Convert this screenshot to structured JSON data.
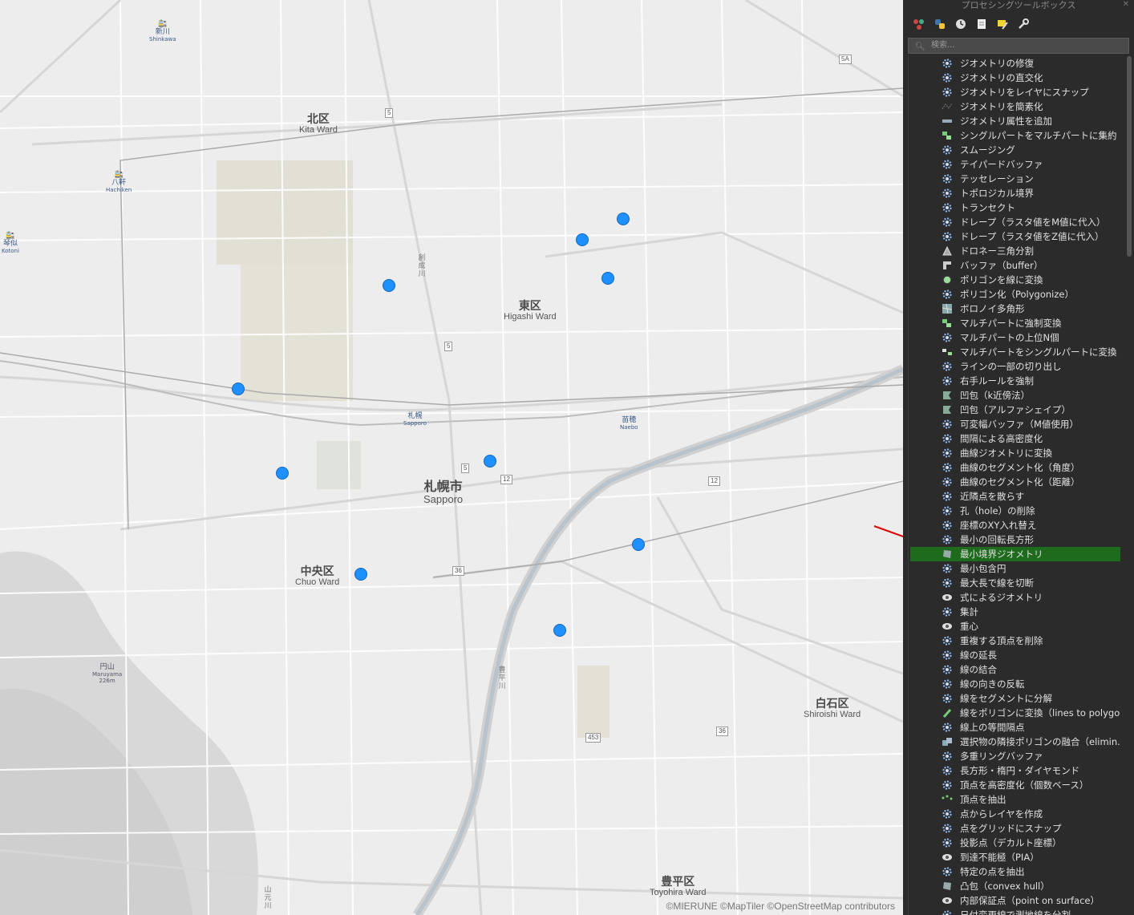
{
  "map": {
    "wards": [
      {
        "jp": "北区",
        "en": "Kita Ward"
      },
      {
        "jp": "東区",
        "en": "Higashi Ward"
      },
      {
        "jp": "札幌市",
        "en": "Sapporo"
      },
      {
        "jp": "中央区",
        "en": "Chuo Ward"
      },
      {
        "jp": "白石区",
        "en": "Shiroishi Ward"
      },
      {
        "jp": "豊平区",
        "en": "Toyohira Ward"
      }
    ],
    "stations": [
      {
        "jp": "新川",
        "en": "Shinkawa"
      },
      {
        "jp": "八軒",
        "en": "Hachiken"
      },
      {
        "jp": "琴似",
        "en": "Kotoni"
      },
      {
        "jp": "札幌",
        "en": "Sapporo"
      },
      {
        "jp": "苗穂",
        "en": "Naebo"
      }
    ],
    "mountain": {
      "jp": "円山",
      "en": "Maruyama",
      "height": "226m"
    },
    "route_shields": [
      "5",
      "5",
      "5",
      "12",
      "12",
      "36",
      "36",
      "453",
      "5A"
    ],
    "river_labels": [
      "創成川",
      "豊平川",
      "山元川"
    ],
    "attribution": "©MIERUNE ©MapTiler ©OpenStreetMap contributors",
    "marker_color": "#1e90ff"
  },
  "panel": {
    "title": "プロセシングツールボックス",
    "search_placeholder": "検索...",
    "selected_color": "#1e6b1e",
    "toolbar": [
      "model-icon",
      "python-icon",
      "history-icon",
      "results-icon",
      "edit-icon",
      "settings-icon"
    ],
    "items": [
      {
        "label": "ジオメトリの修復",
        "icon": "gear"
      },
      {
        "label": "ジオメトリの直交化",
        "icon": "gear"
      },
      {
        "label": "ジオメトリをレイヤにスナップ",
        "icon": "gear"
      },
      {
        "label": "ジオメトリを簡素化",
        "icon": "simplify"
      },
      {
        "label": "ジオメトリ属性を追加",
        "icon": "ruler"
      },
      {
        "label": "シングルパートをマルチパートに集約",
        "icon": "collect"
      },
      {
        "label": "スムージング",
        "icon": "gear"
      },
      {
        "label": "テイパードバッファ",
        "icon": "gear"
      },
      {
        "label": "テッセレーション",
        "icon": "gear"
      },
      {
        "label": "トポロジカル境界",
        "icon": "gear"
      },
      {
        "label": "トランセクト",
        "icon": "gear"
      },
      {
        "label": "ドレープ（ラスタ値をM値に代入）",
        "icon": "gear"
      },
      {
        "label": "ドレープ（ラスタ値をZ値に代入）",
        "icon": "gear"
      },
      {
        "label": "ドロネー三角分割",
        "icon": "delaunay"
      },
      {
        "label": "バッファ（buffer）",
        "icon": "buffer"
      },
      {
        "label": "ポリゴンを線に変換",
        "icon": "polytoline"
      },
      {
        "label": "ポリゴン化（Polygonize）",
        "icon": "gear"
      },
      {
        "label": "ボロノイ多角形",
        "icon": "voronoi"
      },
      {
        "label": "マルチパートに強制変換",
        "icon": "collect"
      },
      {
        "label": "マルチパートの上位N個",
        "icon": "gear"
      },
      {
        "label": "マルチパートをシングルパートに変換",
        "icon": "explode"
      },
      {
        "label": "ラインの一部の切り出し",
        "icon": "gear"
      },
      {
        "label": "右手ルールを強制",
        "icon": "gear"
      },
      {
        "label": "凹包（k近傍法）",
        "icon": "concave"
      },
      {
        "label": "凹包（アルファシェイプ）",
        "icon": "concave"
      },
      {
        "label": "可変幅バッファ（M値使用）",
        "icon": "gear"
      },
      {
        "label": "間隔による高密度化",
        "icon": "gear"
      },
      {
        "label": "曲線ジオメトリに変換",
        "icon": "gear"
      },
      {
        "label": "曲線のセグメント化（角度）",
        "icon": "gear"
      },
      {
        "label": "曲線のセグメント化（距離）",
        "icon": "gear"
      },
      {
        "label": "近隣点を散らす",
        "icon": "gear"
      },
      {
        "label": "孔（hole）の削除",
        "icon": "gear"
      },
      {
        "label": "座標のXY入れ替え",
        "icon": "gear"
      },
      {
        "label": "最小の回転長方形",
        "icon": "gear"
      },
      {
        "label": "最小境界ジオメトリ",
        "icon": "convex",
        "selected": true
      },
      {
        "label": "最小包含円",
        "icon": "gear"
      },
      {
        "label": "最大長で線を切断",
        "icon": "gear"
      },
      {
        "label": "式によるジオメトリ",
        "icon": "expr"
      },
      {
        "label": "集計",
        "icon": "gear"
      },
      {
        "label": "重心",
        "icon": "expr"
      },
      {
        "label": "重複する頂点を削除",
        "icon": "gear"
      },
      {
        "label": "線の延長",
        "icon": "gear"
      },
      {
        "label": "線の結合",
        "icon": "gear"
      },
      {
        "label": "線の向きの反転",
        "icon": "gear"
      },
      {
        "label": "線をセグメントに分解",
        "icon": "gear"
      },
      {
        "label": "線をポリゴンに変換（lines to polygo...",
        "icon": "linetopoly"
      },
      {
        "label": "線上の等間隔点",
        "icon": "gear"
      },
      {
        "label": "選択物の隣接ポリゴンの融合（elimin...",
        "icon": "eliminate"
      },
      {
        "label": "多重リングバッファ",
        "icon": "gear"
      },
      {
        "label": "長方形・楕円・ダイヤモンド",
        "icon": "gear"
      },
      {
        "label": "頂点を高密度化（個数ベース）",
        "icon": "gear"
      },
      {
        "label": "頂点を抽出",
        "icon": "vertices"
      },
      {
        "label": "点からレイヤを作成",
        "icon": "gear"
      },
      {
        "label": "点をグリッドにスナップ",
        "icon": "gear"
      },
      {
        "label": "投影点（デカルト座標）",
        "icon": "gear"
      },
      {
        "label": "到達不能極（PIA）",
        "icon": "expr"
      },
      {
        "label": "特定の点を抽出",
        "icon": "gear"
      },
      {
        "label": "凸包（convex hull）",
        "icon": "convex"
      },
      {
        "label": "内部保証点（point on surface）",
        "icon": "expr"
      },
      {
        "label": "日付変更線で測地線を分割",
        "icon": "gear"
      }
    ]
  }
}
